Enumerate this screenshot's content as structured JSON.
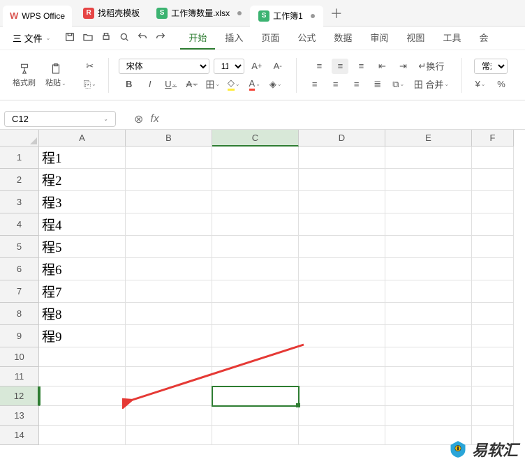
{
  "titlebar": {
    "app_name": "WPS Office",
    "tabs": [
      {
        "label": "找稻壳模板",
        "icon": "R"
      },
      {
        "label": "工作簿数量.xlsx",
        "icon": "S"
      },
      {
        "label": "工作簿1",
        "icon": "S",
        "active": true
      }
    ]
  },
  "menubar": {
    "file_label": "三 文件",
    "items": [
      "开始",
      "插入",
      "页面",
      "公式",
      "数据",
      "审阅",
      "视图",
      "工具",
      "会"
    ],
    "active_index": 0
  },
  "ribbon": {
    "format_brush": "格式刷",
    "paste": "粘贴",
    "font_name": "宋体",
    "font_size": "11",
    "wrap_label": "换行",
    "merge_label": "田 合并",
    "normal_label": "常规"
  },
  "formula_bar": {
    "name_box": "C12",
    "fx": "fx"
  },
  "grid": {
    "columns": [
      "A",
      "B",
      "C",
      "D",
      "E",
      "F"
    ],
    "rows": [
      "1",
      "2",
      "3",
      "4",
      "5",
      "6",
      "7",
      "8",
      "9",
      "10",
      "11",
      "12",
      "13",
      "14"
    ],
    "selected_cell": {
      "row": 12,
      "col": "C"
    },
    "data": {
      "A1": "程1",
      "A2": "程2",
      "A3": "程3",
      "A4": "程4",
      "A5": "程5",
      "A6": "程6",
      "A7": "程7",
      "A8": "程8",
      "A9": "程9"
    }
  },
  "watermark": {
    "text": "易软汇"
  }
}
